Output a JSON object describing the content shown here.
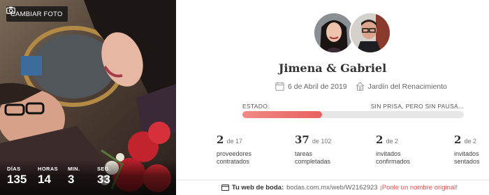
{
  "photo": {
    "change_photo_label": "CAMBIAR FOTO",
    "countdown": [
      {
        "label": "DÍAS",
        "value": "135"
      },
      {
        "label": "HORAS",
        "value": "14"
      },
      {
        "label": "MIN.",
        "value": "3"
      },
      {
        "label": "SEG.",
        "value": "33"
      }
    ]
  },
  "couple": {
    "name": "Jimena & Gabriel",
    "date": "6 de Abril de 2019",
    "venue": "Jardín del Renacimiento"
  },
  "status": {
    "label": "ESTADO:",
    "value": "SIN PRISA, PERO SIN PAUSA...",
    "progress_fraction": 0.36
  },
  "stats": [
    {
      "count": "2",
      "total": "de 17",
      "line1": "proveedores",
      "line2": "contratados"
    },
    {
      "count": "37",
      "total": "de 102",
      "line1": "tareas",
      "line2": "completadas"
    },
    {
      "count": "2",
      "total": "de 2",
      "line1": "invitados",
      "line2": "confirmados"
    },
    {
      "count": "2",
      "total": "de 2",
      "line1": "invitados",
      "line2": "sentados"
    }
  ],
  "footer": {
    "label": "Tu web de boda:",
    "url": "bodas.com.mx/web/W2162923",
    "cta": "¡Ponle un nombre original!"
  },
  "colors": {
    "progress_start": "#f08a85",
    "progress_end": "#e8605e",
    "cta": "#e24d4d"
  }
}
